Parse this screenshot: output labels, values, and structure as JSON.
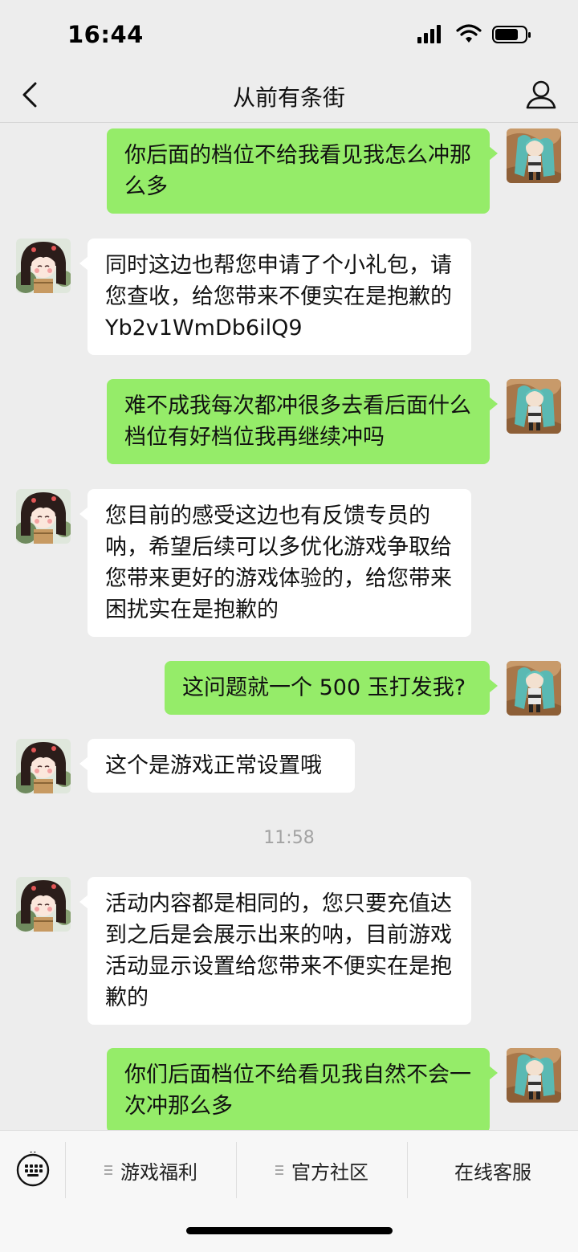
{
  "status_bar": {
    "time": "16:44"
  },
  "header": {
    "title": "从前有条街"
  },
  "messages": [
    {
      "dir": "out",
      "text": "你后面的档位不给我看见我怎么冲那么多"
    },
    {
      "dir": "in",
      "text": "同时这边也帮您申请了个小礼包，请您查收，给您带来不便实在是抱歉的 Yb2v1WmDb6ilQ9"
    },
    {
      "dir": "out",
      "text": "难不成我每次都冲很多去看后面什么档位有好档位我再继续冲吗"
    },
    {
      "dir": "in",
      "text": "您目前的感受这边也有反馈专员的呐，希望后续可以多优化游戏争取给您带来更好的游戏体验的，给您带来困扰实在是抱歉的"
    },
    {
      "dir": "out",
      "text": "这问题就一个 500 玉打发我?"
    },
    {
      "dir": "in",
      "text": "这个是游戏正常设置哦"
    },
    {
      "dir": "in",
      "text": "活动内容都是相同的，您只要充值达到之后是会展示出来的呐，目前游戏活动显示设置给您带来不便实在是抱歉的"
    },
    {
      "dir": "out",
      "text": "你们后面档位不给看见我自然不会一次冲那么多"
    }
  ],
  "timestamp": "11:58",
  "bottom_menu": {
    "items": [
      "游戏福利",
      "官方社区",
      "在线客服"
    ]
  },
  "icons": {
    "back": "chevron-left-icon",
    "profile": "person-icon",
    "keyboard": "keyboard-icon",
    "menu": "menu-lines-icon"
  },
  "colors": {
    "outgoing_bubble": "#95ec69",
    "incoming_bubble": "#ffffff",
    "background": "#ededed"
  }
}
